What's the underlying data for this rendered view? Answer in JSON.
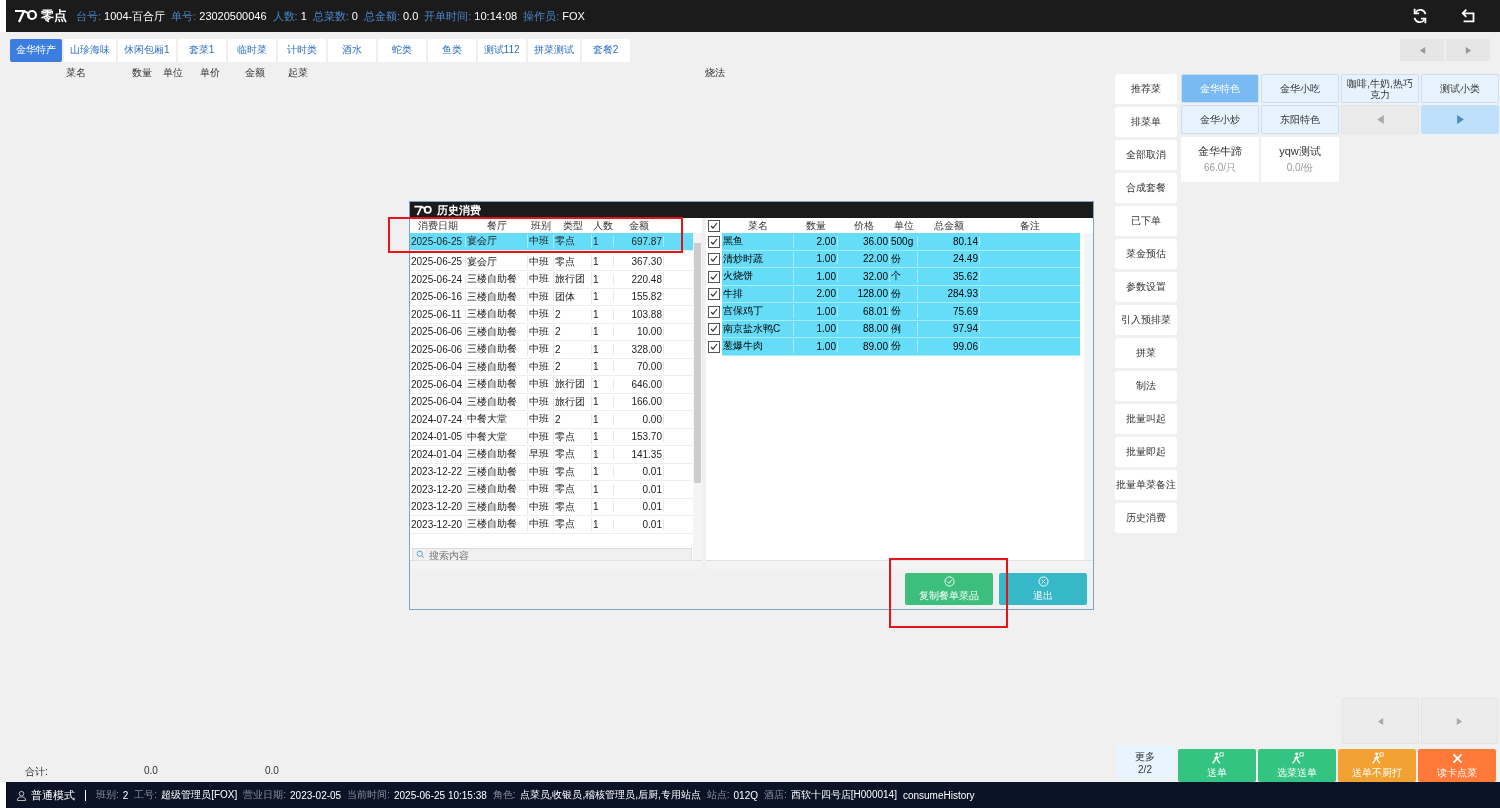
{
  "header": {
    "app_name": "零点",
    "info": [
      {
        "label": "台号:",
        "value": "1004-百合厅"
      },
      {
        "label": "单号:",
        "value": "23020500046"
      },
      {
        "label": "人数:",
        "value": "1"
      },
      {
        "label": "总菜数:",
        "value": "0"
      },
      {
        "label": "总金额:",
        "value": "0.0"
      },
      {
        "label": "开单时间:",
        "value": "10:14:08"
      },
      {
        "label": "操作员:",
        "value": "FOX"
      }
    ]
  },
  "tabs": [
    {
      "label": "金华特产",
      "selected": true
    },
    {
      "label": "山珍海味",
      "selected": false
    },
    {
      "label": "休闲包厢1",
      "selected": false
    },
    {
      "label": "套菜1",
      "selected": false
    },
    {
      "label": "临时菜",
      "selected": false
    },
    {
      "label": "计时类",
      "selected": false
    },
    {
      "label": "酒水",
      "selected": false
    },
    {
      "label": "蛇类",
      "selected": false
    },
    {
      "label": "鱼类",
      "selected": false
    },
    {
      "label": "测试112",
      "selected": false
    },
    {
      "label": "拼菜测试",
      "selected": false
    },
    {
      "label": "套餐2",
      "selected": false
    }
  ],
  "order_columns": [
    "菜名",
    "数量",
    "单位",
    "单价",
    "金额",
    "起菜",
    "烧法"
  ],
  "totals": {
    "label": "合计:",
    "quantity": "0.0",
    "amount": "0.0"
  },
  "functions": [
    "推荐菜",
    "排菜单",
    "全部取消",
    "合成套餐",
    "已下单",
    "菜金预估",
    "参数设置",
    "引入预排菜",
    "拼菜",
    "制法",
    "批量叫起",
    "批量即起",
    "批量单菜备注",
    "历史消费"
  ],
  "categories": [
    {
      "label": "金华特色",
      "selected": true
    },
    {
      "label": "金华小吃",
      "selected": false
    },
    {
      "label": "咖啡,牛奶,热巧克力",
      "selected": false
    },
    {
      "label": "测试小类",
      "selected": false
    },
    {
      "label": "金华小炒",
      "selected": false
    },
    {
      "label": "东阳特色",
      "selected": false
    }
  ],
  "category_nav": {
    "prev_disabled": true,
    "next_disabled": false
  },
  "dishes": [
    {
      "name": "金华牛蹄",
      "price": "66.0/只"
    },
    {
      "name": "yqw测试",
      "price": "0.0/份"
    }
  ],
  "more": {
    "label": "更多",
    "page": "2/2"
  },
  "actions": [
    {
      "label": "送单",
      "color": "#33c481",
      "kind": "walk"
    },
    {
      "label": "选菜送单",
      "color": "#33c481",
      "kind": "walk"
    },
    {
      "label": "送单不厨打",
      "color": "#f2a232",
      "kind": "walk"
    },
    {
      "label": "读卡点菜",
      "color": "#ff7a38",
      "kind": "cross"
    }
  ],
  "dialog": {
    "title": "历史消费",
    "history_columns": [
      "消费日期",
      "餐厅",
      "班别",
      "类型",
      "人数",
      "金额"
    ],
    "history_rows": [
      {
        "cells": [
          "2025-06-25",
          "宴会厅",
          "中班",
          "零点",
          "1",
          "697.87"
        ],
        "selected": true
      },
      {
        "cells": [
          "2025-06-25",
          "宴会厅",
          "中班",
          "零点",
          "1",
          "367.30"
        ],
        "selected": false
      },
      {
        "cells": [
          "2025-06-24",
          "三楼自助餐",
          "中班",
          "旅行团",
          "1",
          "220.48"
        ],
        "selected": false
      },
      {
        "cells": [
          "2025-06-16",
          "三楼自助餐",
          "中班",
          "团体",
          "1",
          "155.82"
        ],
        "selected": false
      },
      {
        "cells": [
          "2025-06-11",
          "三楼自助餐",
          "中班",
          "2",
          "1",
          "103.88"
        ],
        "selected": false
      },
      {
        "cells": [
          "2025-06-06",
          "三楼自助餐",
          "中班",
          "2",
          "1",
          "10.00"
        ],
        "selected": false
      },
      {
        "cells": [
          "2025-06-06",
          "三楼自助餐",
          "中班",
          "2",
          "1",
          "328.00"
        ],
        "selected": false
      },
      {
        "cells": [
          "2025-06-04",
          "三楼自助餐",
          "中班",
          "2",
          "1",
          "70.00"
        ],
        "selected": false
      },
      {
        "cells": [
          "2025-06-04",
          "三楼自助餐",
          "中班",
          "旅行团",
          "1",
          "646.00"
        ],
        "selected": false
      },
      {
        "cells": [
          "2025-06-04",
          "三楼自助餐",
          "中班",
          "旅行团",
          "1",
          "166.00"
        ],
        "selected": false
      },
      {
        "cells": [
          "2024-07-24",
          "中餐大堂",
          "中班",
          "2",
          "1",
          "0.00"
        ],
        "selected": false
      },
      {
        "cells": [
          "2024-01-05",
          "中餐大堂",
          "中班",
          "零点",
          "1",
          "153.70"
        ],
        "selected": false
      },
      {
        "cells": [
          "2024-01-04",
          "三楼自助餐",
          "早班",
          "零点",
          "1",
          "141.35"
        ],
        "selected": false
      },
      {
        "cells": [
          "2023-12-22",
          "三楼自助餐",
          "中班",
          "零点",
          "1",
          "0.01"
        ],
        "selected": false
      },
      {
        "cells": [
          "2023-12-20",
          "三楼自助餐",
          "中班",
          "零点",
          "1",
          "0.01"
        ],
        "selected": false
      },
      {
        "cells": [
          "2023-12-20",
          "三楼自助餐",
          "中班",
          "零点",
          "1",
          "0.01"
        ],
        "selected": false
      },
      {
        "cells": [
          "2023-12-20",
          "三楼自助餐",
          "中班",
          "零点",
          "1",
          "0.01"
        ],
        "selected": false
      }
    ],
    "search": {
      "placeholder": "搜索内容"
    },
    "all_checked": true,
    "item_columns": [
      "菜名",
      "数量",
      "价格",
      "单位",
      "总金额",
      "备注"
    ],
    "item_rows": [
      {
        "cells": [
          "黑鱼",
          "2.00",
          "36.00",
          "500g",
          "80.14"
        ],
        "checked": true
      },
      {
        "cells": [
          "清炒时蔬",
          "1.00",
          "22.00",
          "份",
          "24.49"
        ],
        "checked": true
      },
      {
        "cells": [
          "火烧饼",
          "1.00",
          "32.00",
          "个",
          "35.62"
        ],
        "checked": true
      },
      {
        "cells": [
          "牛排",
          "2.00",
          "128.00",
          "份",
          "284.93"
        ],
        "checked": true
      },
      {
        "cells": [
          "宫保鸡丁",
          "1.00",
          "68.01",
          "份",
          "75.69"
        ],
        "checked": true
      },
      {
        "cells": [
          "南京盐水鸭C",
          "1.00",
          "88.00",
          "例",
          "97.94"
        ],
        "checked": true
      },
      {
        "cells": [
          "葱爆牛肉",
          "1.00",
          "89.00",
          "份",
          "99.06"
        ],
        "checked": true
      }
    ],
    "buttons": [
      {
        "label": "复制餐单菜品",
        "kind": "confirm"
      },
      {
        "label": "退出",
        "kind": "exit"
      }
    ]
  },
  "status_bar": {
    "mode": "普通模式",
    "fields": [
      {
        "label": "班别:",
        "value": "2"
      },
      {
        "label": "工号:",
        "value": "超级管理员[FOX]"
      },
      {
        "label": "营业日期:",
        "value": "2023-02-05"
      },
      {
        "label": "当前时间:",
        "value": "2025-06-25 10:15:38"
      },
      {
        "label": "角色:",
        "value": "点菜员,收银员,稽核管理员,后厨,专用站点"
      },
      {
        "label": "站点:",
        "value": "012Q"
      },
      {
        "label": "酒店:",
        "value": "西软十四号店[H000014]"
      }
    ],
    "page": "consumeHistory"
  }
}
